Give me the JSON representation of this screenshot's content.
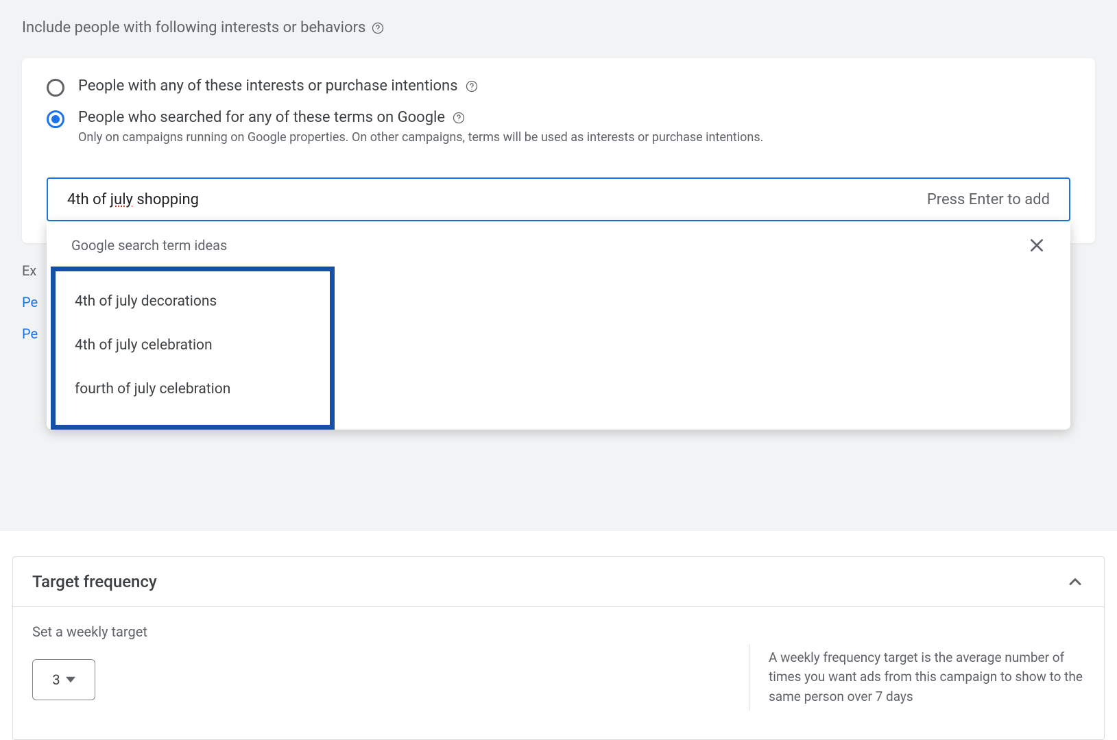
{
  "section": {
    "label": "Include people with following interests or behaviors"
  },
  "radios": {
    "interests": {
      "label": "People with any of these interests or purchase intentions"
    },
    "searched": {
      "label": "People who searched for any of these terms on Google",
      "sublabel": "Only on campaigns running on Google properties. On other campaigns, terms will be used as interests or purchase intentions."
    }
  },
  "search": {
    "value_prefix": "4th of ",
    "value_underlined": "july",
    "value_suffix": " shopping",
    "enter_hint": "Press Enter to add"
  },
  "dropdown": {
    "header": "Google search term ideas",
    "suggestions": [
      "4th of july decorations",
      "4th of july celebration",
      "fourth of july celebration"
    ]
  },
  "below": {
    "expand_prefix": "Ex",
    "link_prefix": "Pe"
  },
  "target_frequency": {
    "title": "Target frequency",
    "sublabel": "Set a weekly target",
    "value": "3",
    "help_text": "A weekly frequency target is the average number of times you want ads from this campaign to show to the same person over 7 days"
  }
}
